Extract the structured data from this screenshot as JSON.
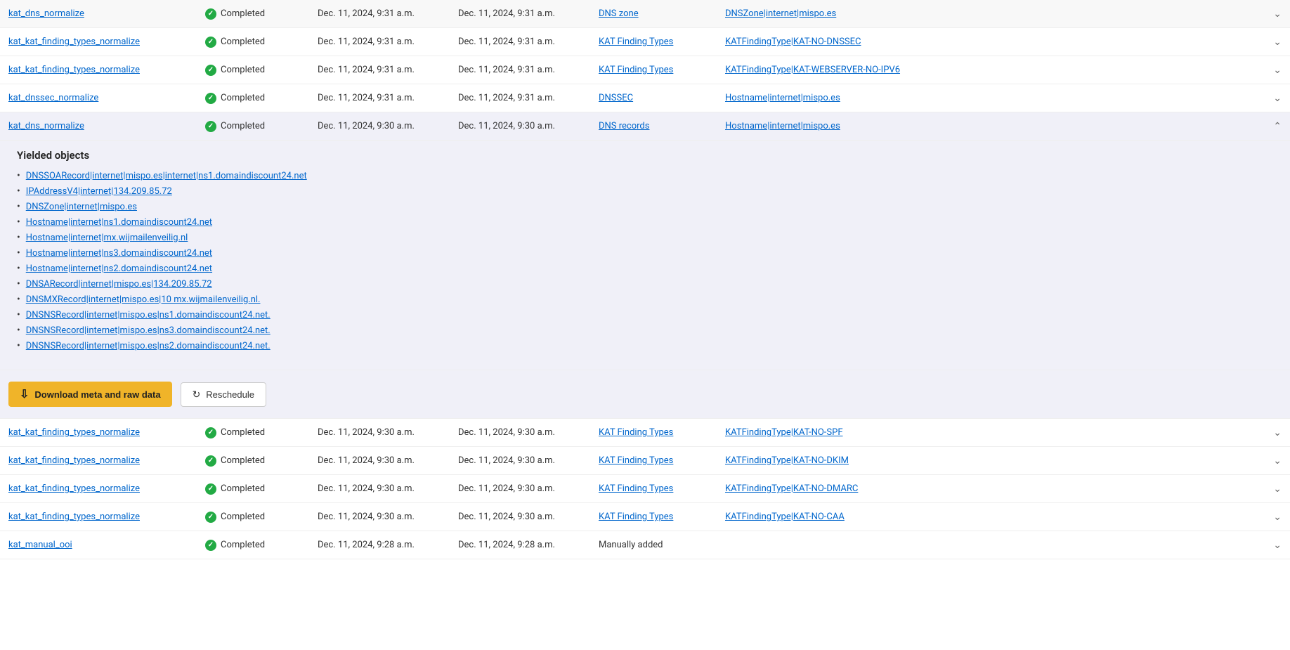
{
  "colors": {
    "accent": "#f0b429",
    "link": "#0066cc",
    "status_completed": "#22aa44"
  },
  "top_rows": [
    {
      "task": "kat_dns_normalize",
      "status": "Completed",
      "start": "Dec. 11, 2024, 9:31 a.m.",
      "end": "Dec. 11, 2024, 9:31 a.m.",
      "object_type": "DNS zone",
      "result": "DNSZone|internet|mispo.es",
      "expanded": false
    },
    {
      "task": "kat_kat_finding_types_normalize",
      "status": "Completed",
      "start": "Dec. 11, 2024, 9:31 a.m.",
      "end": "Dec. 11, 2024, 9:31 a.m.",
      "object_type": "KAT Finding Types",
      "result": "KATFindingType|KAT-NO-DNSSEC",
      "expanded": false
    },
    {
      "task": "kat_kat_finding_types_normalize",
      "status": "Completed",
      "start": "Dec. 11, 2024, 9:31 a.m.",
      "end": "Dec. 11, 2024, 9:31 a.m.",
      "object_type": "KAT Finding Types",
      "result": "KATFindingType|KAT-WEBSERVER-NO-IPV6",
      "expanded": false
    },
    {
      "task": "kat_dnssec_normalize",
      "status": "Completed",
      "start": "Dec. 11, 2024, 9:31 a.m.",
      "end": "Dec. 11, 2024, 9:31 a.m.",
      "object_type": "DNSSEC",
      "result": "Hostname|internet|mispo.es",
      "expanded": false
    }
  ],
  "expanded_row": {
    "task": "kat_dns_normalize",
    "status": "Completed",
    "start": "Dec. 11, 2024, 9:30 a.m.",
    "end": "Dec. 11, 2024, 9:30 a.m.",
    "object_type": "DNS records",
    "result": "Hostname|internet|mispo.es",
    "expanded": true
  },
  "yielded_section": {
    "title": "Yielded objects",
    "items": [
      "DNSSOARecord|internet|mispo.es|internet|ns1.domaindiscount24.net",
      "IPAddressV4|internet|134.209.85.72",
      "DNSZone|internet|mispo.es",
      "Hostname|internet|ns1.domaindiscount24.net",
      "Hostname|internet|mx.wijmailenveilig.nl",
      "Hostname|internet|ns3.domaindiscount24.net",
      "Hostname|internet|ns2.domaindiscount24.net",
      "DNSARecord|internet|mispo.es|134.209.85.72",
      "DNSMXRecord|internet|mispo.es|10 mx.wijmailenveilig.nl.",
      "DNSNSRecord|internet|mispo.es|ns1.domaindiscount24.net.",
      "DNSNSRecord|internet|mispo.es|ns3.domaindiscount24.net.",
      "DNSNSRecord|internet|mispo.es|ns2.domaindiscount24.net."
    ]
  },
  "action_bar": {
    "download_label": "Download meta and raw data",
    "reschedule_label": "Reschedule"
  },
  "bottom_rows": [
    {
      "task": "kat_kat_finding_types_normalize",
      "status": "Completed",
      "start": "Dec. 11, 2024, 9:30 a.m.",
      "end": "Dec. 11, 2024, 9:30 a.m.",
      "object_type": "KAT Finding Types",
      "result": "KATFindingType|KAT-NO-SPF",
      "expanded": false
    },
    {
      "task": "kat_kat_finding_types_normalize",
      "status": "Completed",
      "start": "Dec. 11, 2024, 9:30 a.m.",
      "end": "Dec. 11, 2024, 9:30 a.m.",
      "object_type": "KAT Finding Types",
      "result": "KATFindingType|KAT-NO-DKIM",
      "expanded": false
    },
    {
      "task": "kat_kat_finding_types_normalize",
      "status": "Completed",
      "start": "Dec. 11, 2024, 9:30 a.m.",
      "end": "Dec. 11, 2024, 9:30 a.m.",
      "object_type": "KAT Finding Types",
      "result": "KATFindingType|KAT-NO-DMARC",
      "expanded": false
    },
    {
      "task": "kat_kat_finding_types_normalize",
      "status": "Completed",
      "start": "Dec. 11, 2024, 9:30 a.m.",
      "end": "Dec. 11, 2024, 9:30 a.m.",
      "object_type": "KAT Finding Types",
      "result": "KATFindingType|KAT-NO-CAA",
      "expanded": false
    },
    {
      "task": "kat_manual_ooi",
      "status": "Completed",
      "start": "Dec. 11, 2024, 9:28 a.m.",
      "end": "Dec. 11, 2024, 9:28 a.m.",
      "object_type": "Manually added",
      "result": "",
      "expanded": false
    }
  ]
}
